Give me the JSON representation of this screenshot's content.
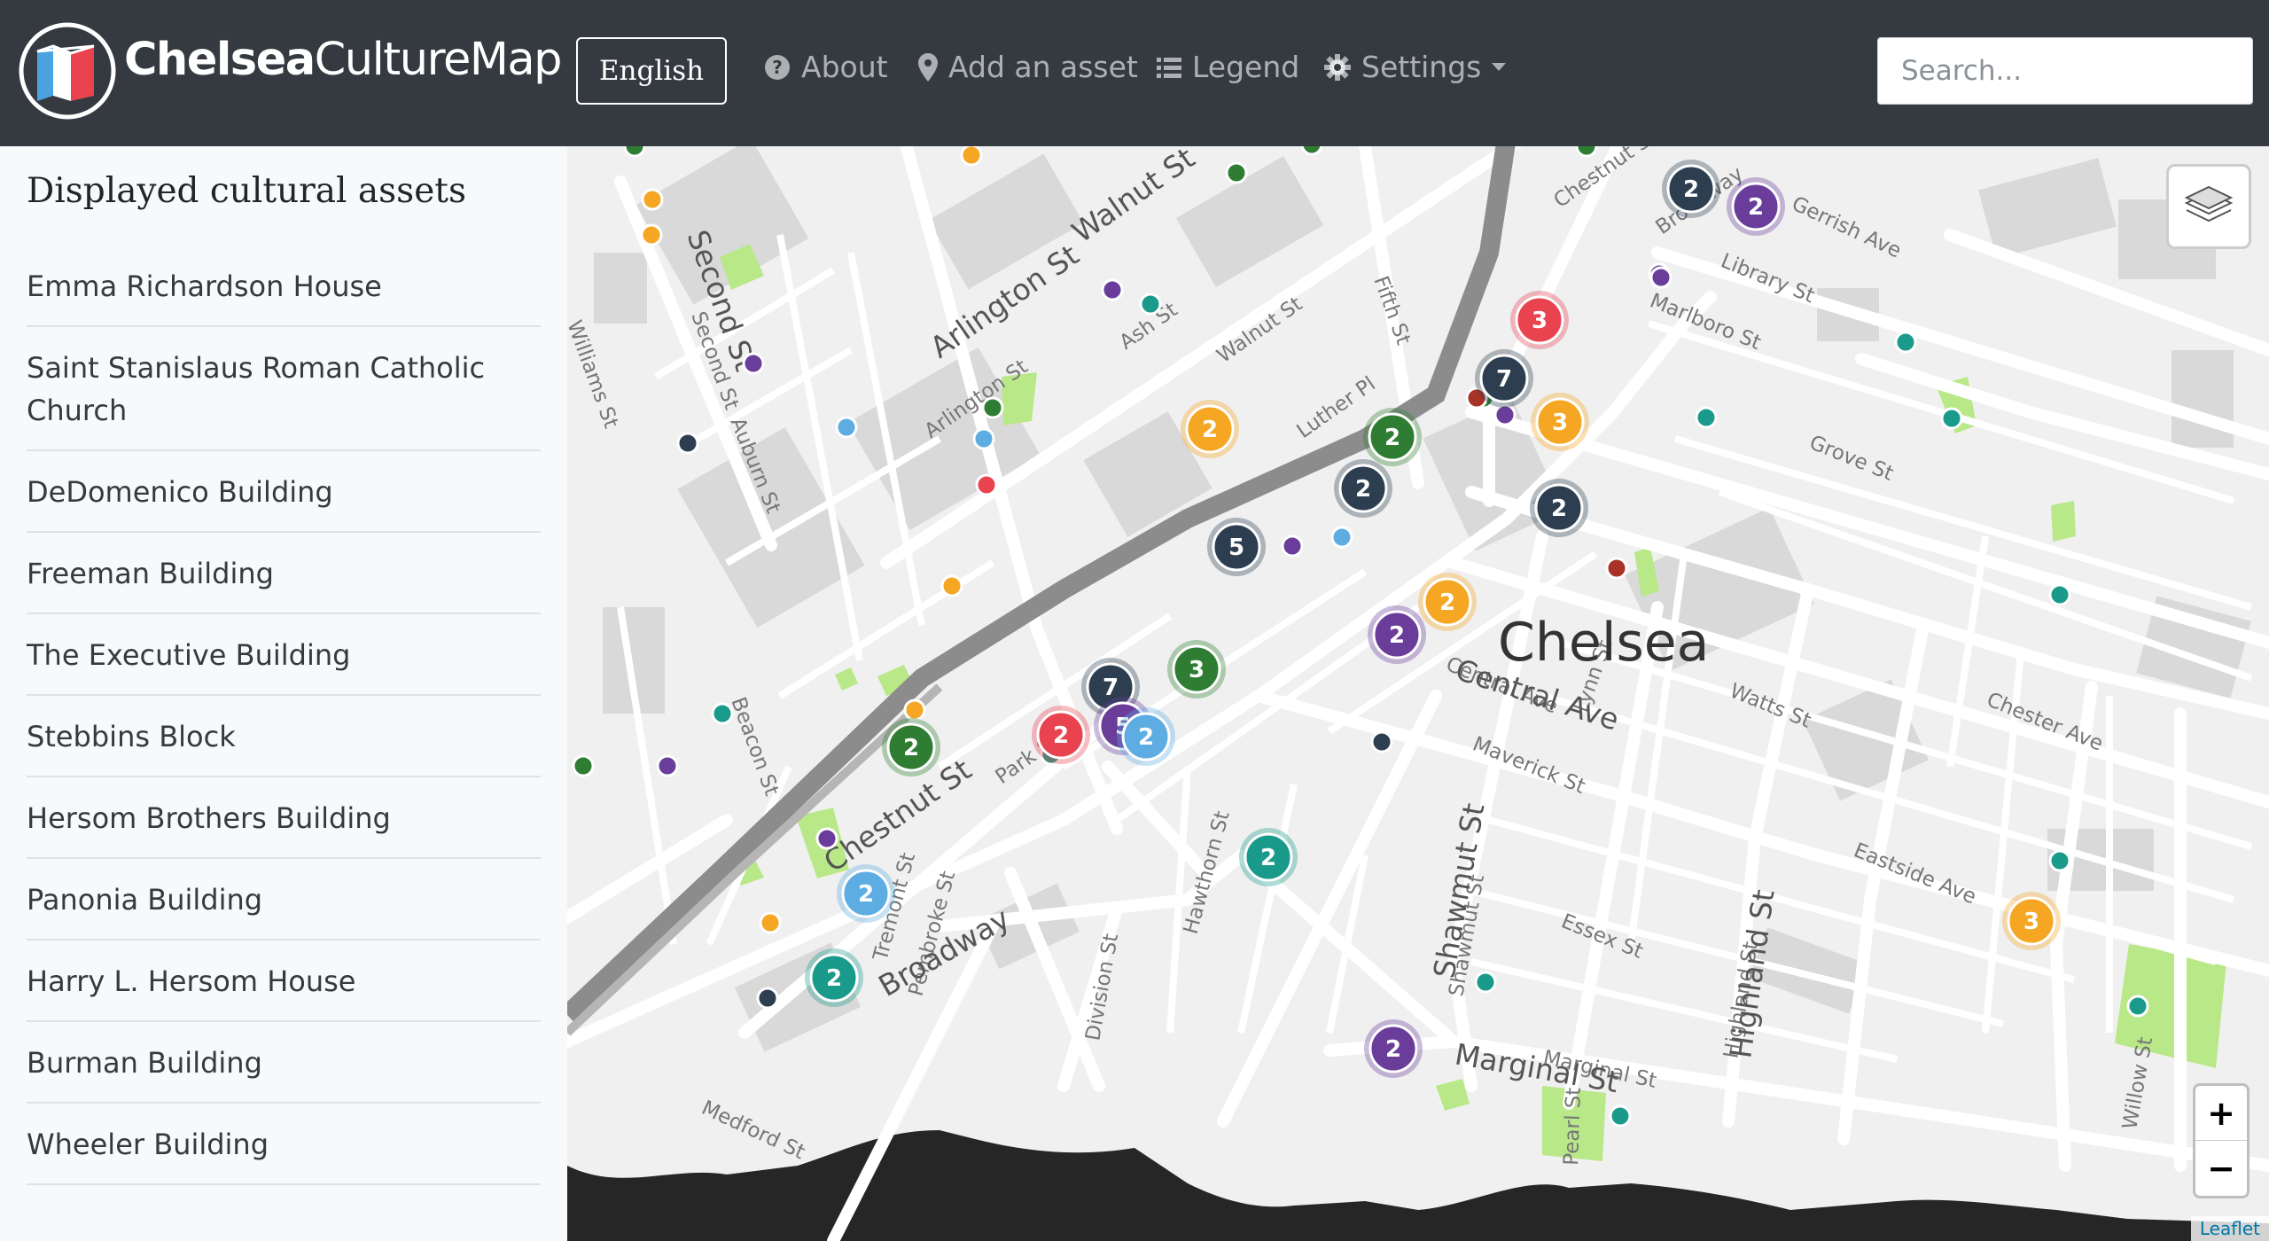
{
  "app": {
    "brand_bold": "Chelsea",
    "brand_light": "CultureMap"
  },
  "nav": {
    "language_button": "English",
    "about": "About",
    "add_asset": "Add an asset",
    "legend": "Legend",
    "settings": "Settings",
    "search_placeholder": "Search..."
  },
  "sidebar": {
    "title": "Displayed cultural assets",
    "items": [
      "Emma Richardson House",
      "Saint Stanislaus Roman Catholic Church",
      "DeDomenico Building",
      "Freeman Building",
      "The Executive Building",
      "Stebbins Block",
      "Hersom Brothers Building",
      "Panonia Building",
      "Harry L. Hersom House",
      "Burman Building",
      "Wheeler Building"
    ]
  },
  "map": {
    "city_label": "Chelsea",
    "streets": [
      "Second St",
      "Williams St",
      "Auburn St",
      "Arlington St",
      "Ash St",
      "Walnut St",
      "Fifth St",
      "Chestnut St",
      "Broadway",
      "Gerrish Ave",
      "Library St",
      "Marlboro St",
      "Luther Pl",
      "Grove St",
      "Central Ave",
      "Lynn St",
      "Watts St",
      "Chester Ave",
      "Maverick St",
      "Eastside Ave",
      "Essex St",
      "Shawmut St",
      "Highland St",
      "Marginal St",
      "Willow St",
      "Pearl St",
      "Division St",
      "Hawthorn St",
      "Pembroke St",
      "Tremont St",
      "Beacon St",
      "Medford St",
      "Park St"
    ],
    "zoom_in": "+",
    "zoom_out": "−",
    "attribution": "Leaflet",
    "layers_icon": "layers-icon",
    "colors": {
      "navy": "#2c3e50",
      "purple": "#6a3d9a",
      "red": "#e8434f",
      "orange": "#f5a623",
      "green": "#2e7d32",
      "teal": "#1a9a8a",
      "lightblue": "#5dade2",
      "darkred": "#a93226"
    },
    "clusters": [
      {
        "label": "2",
        "color": "navy"
      },
      {
        "label": "2",
        "color": "purple"
      },
      {
        "label": "3",
        "color": "red"
      },
      {
        "label": "7",
        "color": "navy"
      },
      {
        "label": "3",
        "color": "orange"
      },
      {
        "label": "2",
        "color": "orange"
      },
      {
        "label": "2",
        "color": "green"
      },
      {
        "label": "2",
        "color": "navy"
      },
      {
        "label": "2",
        "color": "navy"
      },
      {
        "label": "5",
        "color": "navy"
      },
      {
        "label": "2",
        "color": "orange"
      },
      {
        "label": "2",
        "color": "purple"
      },
      {
        "label": "3",
        "color": "green"
      },
      {
        "label": "7",
        "color": "navy"
      },
      {
        "label": "2",
        "color": "red"
      },
      {
        "label": "5",
        "color": "purple"
      },
      {
        "label": "2",
        "color": "lightblue"
      },
      {
        "label": "2",
        "color": "green"
      },
      {
        "label": "2",
        "color": "teal"
      },
      {
        "label": "2",
        "color": "lightblue"
      },
      {
        "label": "2",
        "color": "teal"
      },
      {
        "label": "3",
        "color": "orange"
      },
      {
        "label": "2",
        "color": "purple"
      }
    ]
  }
}
